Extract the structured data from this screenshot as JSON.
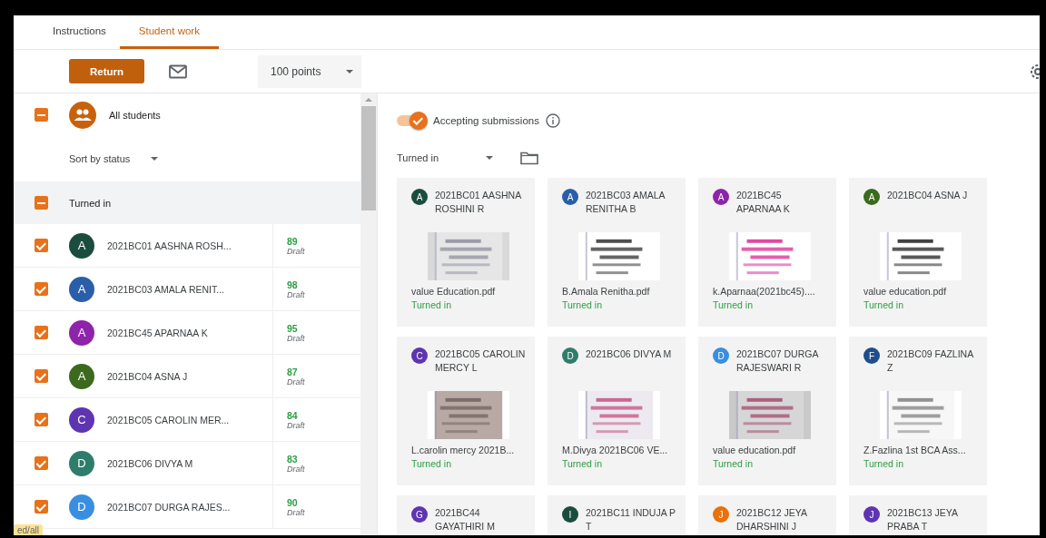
{
  "tabs": [
    {
      "label": "Instructions",
      "selected": false
    },
    {
      "label": "Student work",
      "selected": true
    }
  ],
  "toolbar": {
    "return_button": "Return",
    "points": "100 points"
  },
  "roster": {
    "all_students": {
      "label": "All students",
      "indeterminate": true
    },
    "sort": "Sort by status",
    "group": {
      "label": "Turned in",
      "indeterminate": true
    },
    "students": [
      {
        "initial": "A",
        "color": "#1b4d3e",
        "name": "2021BC01 AASHNA ROSH...",
        "score": "89",
        "status": "Draft",
        "checked": true
      },
      {
        "initial": "A",
        "color": "#2a5ea8",
        "name": "2021BC03 AMALA RENIT...",
        "score": "98",
        "status": "Draft",
        "checked": true
      },
      {
        "initial": "A",
        "color": "#8e24aa",
        "name": "2021BC45 APARNAA K",
        "score": "95",
        "status": "Draft",
        "checked": true
      },
      {
        "initial": "A",
        "color": "#3b6a1e",
        "name": "2021BC04 ASNA J",
        "score": "87",
        "status": "Draft",
        "checked": true
      },
      {
        "initial": "C",
        "color": "#5e35b1",
        "name": "2021BC05 CAROLIN MER...",
        "score": "84",
        "status": "Draft",
        "checked": true
      },
      {
        "initial": "D",
        "color": "#2e7d6a",
        "name": "2021BC06 DIVYA M",
        "score": "83",
        "status": "Draft",
        "checked": true
      },
      {
        "initial": "D",
        "color": "#3a8ee0",
        "name": "2021BC07 DURGA RAJES...",
        "score": "90",
        "status": "Draft",
        "checked": true
      }
    ],
    "tooltip": "ed/all"
  },
  "work": {
    "accepting": {
      "label": "Accepting submissions",
      "on": true
    },
    "filter": "Turned in",
    "cards": [
      {
        "initial": "A",
        "color": "#1b4d3e",
        "name": "2021BC01 AASHNA ROSHINI R",
        "file": "value Education.pdf",
        "status": "Turned in"
      },
      {
        "initial": "A",
        "color": "#2a5ea8",
        "name": "2021BC03 AMALA RENITHA B",
        "file": "B.Amala Renitha.pdf",
        "status": "Turned in"
      },
      {
        "initial": "A",
        "color": "#8e24aa",
        "name": "2021BC45 APARNAA K",
        "file": "k.Aparnaa(2021bc45)....",
        "status": "Turned in"
      },
      {
        "initial": "A",
        "color": "#3b6a1e",
        "name": "2021BC04 ASNA J",
        "file": "value education.pdf",
        "status": "Turned in"
      },
      {
        "initial": "C",
        "color": "#5e35b1",
        "name": "2021BC05 CAROLIN MERCY L",
        "file": "L.carolin mercy 2021B...",
        "status": "Turned in"
      },
      {
        "initial": "D",
        "color": "#2e7d6a",
        "name": "2021BC06 DIVYA M",
        "file": "M.Divya 2021BC06 VE...",
        "status": "Turned in"
      },
      {
        "initial": "D",
        "color": "#3a8ee0",
        "name": "2021BC07 DURGA RAJESWARI R",
        "file": "value education.pdf",
        "status": "Turned in"
      },
      {
        "initial": "F",
        "color": "#1f4e8c",
        "name": "2021BC09 FAZLINA Z",
        "file": "Z.Fazlina 1st BCA Ass...",
        "status": "Turned in"
      },
      {
        "initial": "G",
        "color": "#5e35b1",
        "name": "2021BC44 GAYATHIRI M"
      },
      {
        "initial": "I",
        "color": "#1b4d3e",
        "name": "2021BC11 INDUJA P T"
      },
      {
        "initial": "J",
        "color": "#e8710a",
        "name": "2021BC12 JEYA DHARSHINI J"
      },
      {
        "initial": "J",
        "color": "#5e35b1",
        "name": "2021BC13 JEYA PRABA T"
      }
    ]
  }
}
